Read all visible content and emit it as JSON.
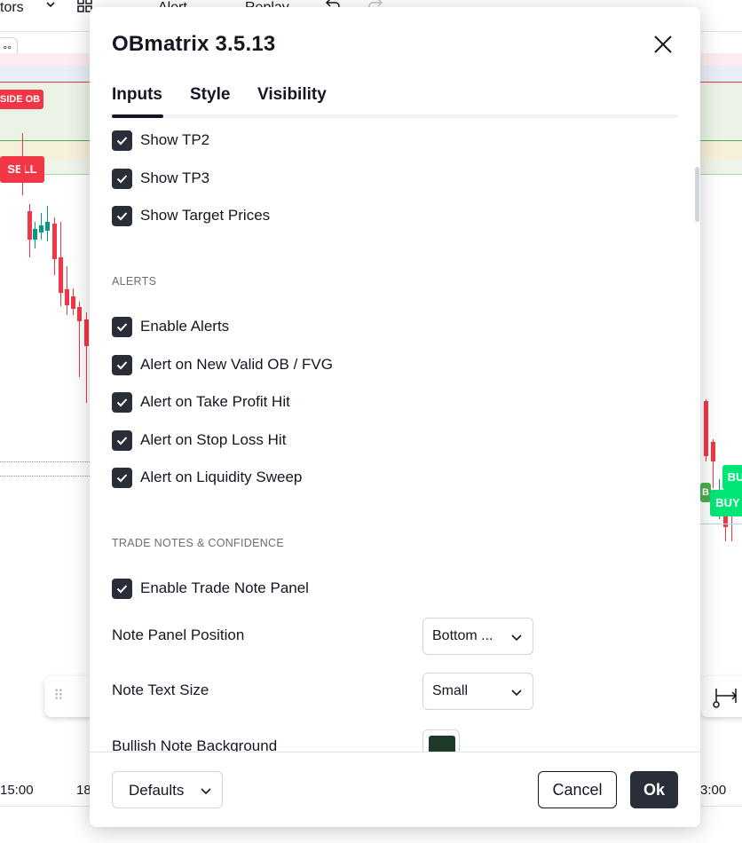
{
  "toolbar": {
    "indicators_label": "tors",
    "alert_label": "Alert",
    "replay_label": "Replay"
  },
  "chart": {
    "sell_tag": "SELL",
    "side_ob_tag": "SIDE OB",
    "buy_tag": "BUY",
    "buy_tag_2": "BU",
    "b_tag": "B",
    "time_labels": [
      "15:00",
      "18",
      "3:00"
    ],
    "colors": {
      "sell": "#f23645",
      "buy": "#00e676",
      "up_candle": "#089981",
      "down_candle": "#f23645"
    }
  },
  "dialog": {
    "title": "OBmatrix 3.5.13",
    "tabs": [
      {
        "label": "Inputs",
        "active": true
      },
      {
        "label": "Style",
        "active": false
      },
      {
        "label": "Visibility",
        "active": false
      }
    ],
    "checkboxes_top": [
      {
        "label": "Show TP2",
        "checked": true
      },
      {
        "label": "Show TP3",
        "checked": true
      },
      {
        "label": "Show Target Prices",
        "checked": true
      }
    ],
    "alerts_section": "ALERTS",
    "alerts": [
      {
        "label": "Enable Alerts",
        "checked": true
      },
      {
        "label": "Alert on New Valid OB / FVG",
        "checked": true
      },
      {
        "label": "Alert on Take Profit Hit",
        "checked": true
      },
      {
        "label": "Alert on Stop Loss Hit",
        "checked": true
      },
      {
        "label": "Alert on Liquidity Sweep",
        "checked": true
      }
    ],
    "notes_section": "TRADE NOTES & CONFIDENCE",
    "notes_checkbox": {
      "label": "Enable Trade Note Panel",
      "checked": true
    },
    "note_panel_position": {
      "label": "Note Panel Position",
      "value": "Bottom ..."
    },
    "note_text_size": {
      "label": "Note Text Size",
      "value": "Small"
    },
    "bullish_note_bg": {
      "label": "Bullish Note Background",
      "color": "#1e3b2a"
    },
    "footer": {
      "defaults_label": "Defaults",
      "cancel_label": "Cancel",
      "ok_label": "Ok"
    }
  }
}
